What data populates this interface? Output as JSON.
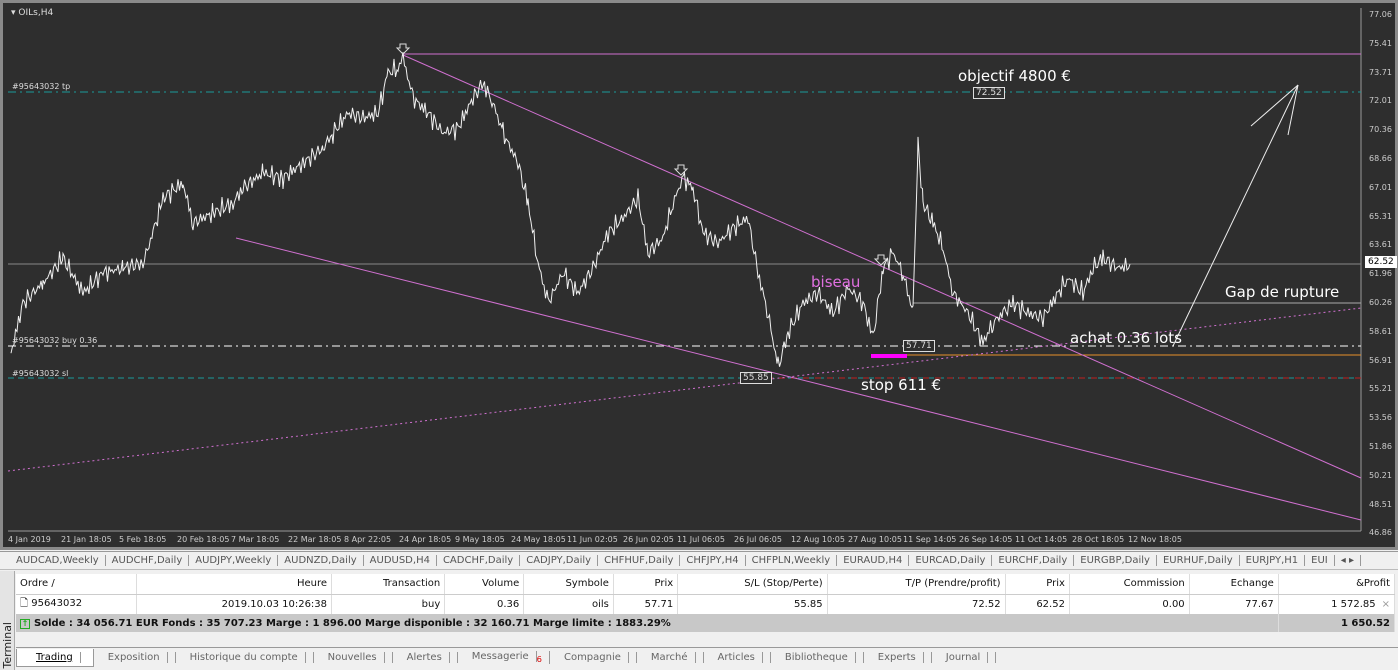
{
  "chart": {
    "title": "OILs,H4",
    "tp_label": "#95643032 tp",
    "buy_label": "#95643032 buy 0.36",
    "sl_label": "#95643032 sl",
    "tp_box": "72.52",
    "open_box": "57.71",
    "sl_box": "55.85",
    "price_box": "62.52",
    "annotations": {
      "objectif": "objectif 4800 €",
      "biseau": "biseau",
      "gap": "Gap de rupture",
      "achat": "achat 0.36 lots",
      "stop": "stop 611 €"
    },
    "price_axis": [
      "77.06",
      "75.41",
      "73.71",
      "72.01",
      "70.36",
      "68.66",
      "67.01",
      "65.31",
      "63.61",
      "61.96",
      "60.26",
      "58.61",
      "56.91",
      "55.21",
      "53.56",
      "51.86",
      "50.21",
      "48.51",
      "46.86"
    ],
    "time_axis": [
      "4 Jan 2019",
      "21 Jan 18:05",
      "5 Feb 18:05",
      "20 Feb 18:05",
      "7 Mar 18:05",
      "22 Mar 18:05",
      "8 Apr 22:05",
      "24 Apr 18:05",
      "9 May 18:05",
      "24 May 18:05",
      "11 Jun 02:05",
      "26 Jun 02:05",
      "11 Jul 06:05",
      "26 Jul 06:05",
      "12 Aug 10:05",
      "27 Aug 10:05",
      "11 Sep 14:05",
      "26 Sep 14:05",
      "11 Oct 14:05",
      "28 Oct 18:05",
      "12 Nov 18:05"
    ],
    "colors": {
      "bg": "#2e2e2e",
      "trend": "#d070d0",
      "tp": "#1a9a9a",
      "orange": "#e8902a",
      "marker": "#ff00ff",
      "price": "#f0f0f0"
    }
  },
  "symbol_tabs": [
    "AUDCAD,Weekly",
    "AUDCHF,Daily",
    "AUDJPY,Weekly",
    "AUDNZD,Daily",
    "AUDUSD,H4",
    "CADCHF,Daily",
    "CADJPY,Daily",
    "CHFHUF,Daily",
    "CHFJPY,H4",
    "CHFPLN,Weekly",
    "EURAUD,H4",
    "EURCAD,Daily",
    "EURCHF,Daily",
    "EURGBP,Daily",
    "EURHUF,Daily",
    "EURJPY,H1",
    "EUI"
  ],
  "terminal": {
    "label": "Terminal",
    "columns": [
      "Ordre  /",
      "Heure",
      "Transaction",
      "Volume",
      "Symbole",
      "Prix",
      "S/L (Stop/Perte)",
      "T/P (Prendre/profit)",
      "Prix",
      "Commission",
      "Echange",
      "&Profit"
    ],
    "row": [
      "95643032",
      "2019.10.03 10:26:38",
      "buy",
      "0.36",
      "oils",
      "57.71",
      "55.85",
      "72.52",
      "62.52",
      "0.00",
      "77.67",
      "1 572.85"
    ],
    "summary": "Solde : 34 056.71 EUR  Fonds : 35 707.23  Marge : 1 896.00  Marge disponible : 32 160.71  Marge limite : 1883.29%",
    "total": "1 650.52",
    "tabs": [
      "Trading",
      "Exposition",
      "Historique du compte",
      "Nouvelles",
      "Alertes",
      "Messagerie",
      "Compagnie",
      "Marché",
      "Articles",
      "Bibliotheque",
      "Experts",
      "Journal"
    ],
    "mail_count": "6"
  }
}
